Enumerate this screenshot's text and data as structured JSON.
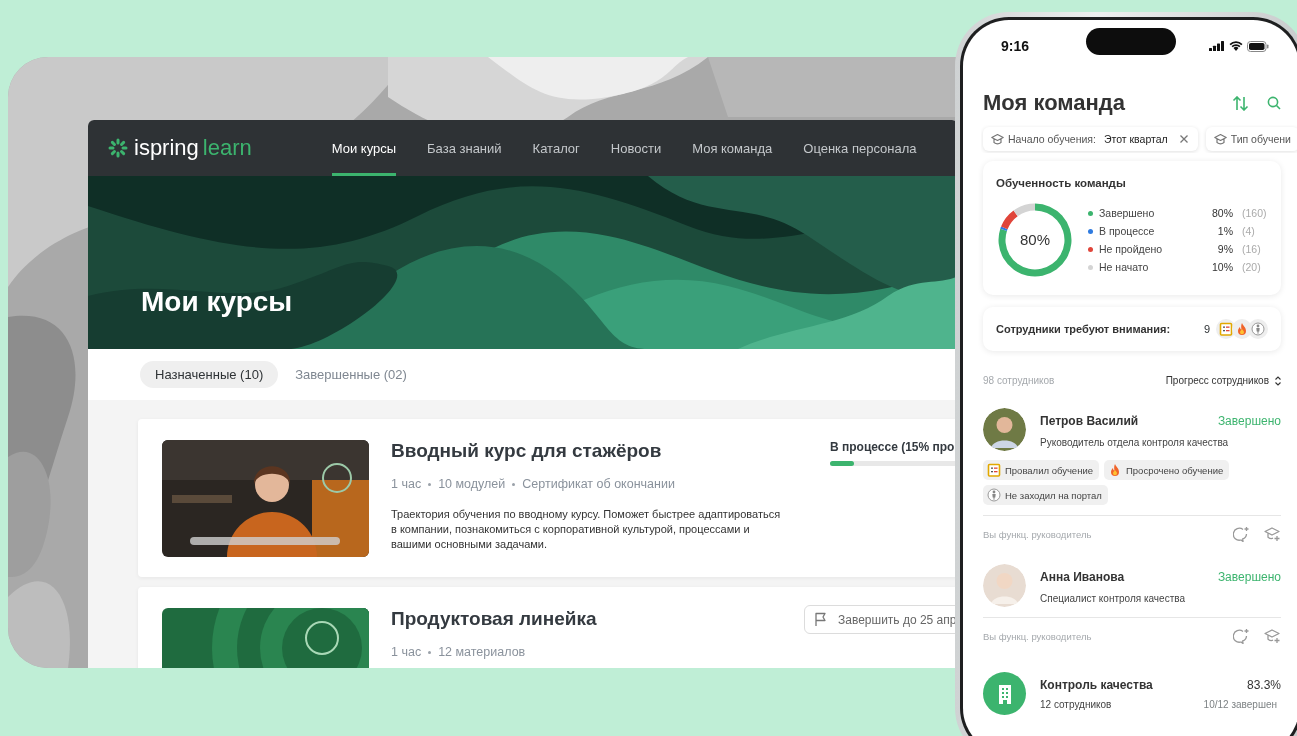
{
  "desktop": {
    "logo": {
      "brand": "ispring",
      "product": "learn"
    },
    "nav": [
      {
        "label": "Мои курсы",
        "selected": true
      },
      {
        "label": "База знаний",
        "selected": false
      },
      {
        "label": "Каталог",
        "selected": false
      },
      {
        "label": "Новости",
        "selected": false
      },
      {
        "label": "Моя команда",
        "selected": false
      },
      {
        "label": "Оценка персонала",
        "selected": false
      }
    ],
    "hero_title": "Мои курсы",
    "tabs": [
      {
        "label": "Назначенные (10)",
        "selected": true
      },
      {
        "label": "Завершенные (02)",
        "selected": false
      }
    ],
    "courses": [
      {
        "kind": "picture",
        "title": "Вводный курс для стажёров",
        "meta": [
          "1 час",
          "10 модулей",
          "Сертификат об окончании"
        ],
        "description": "Траектория обучения по вводному курсу. Поможет быстрее адаптироваться в компании, познакомиться с корпоративной культурой, процессами и вашими основными задачами.",
        "status": {
          "kind": "progress",
          "label": "В процессе (15% про",
          "level": 0.15
        }
      },
      {
        "kind": "picture",
        "title": "Продуктовая линейка",
        "meta": [
          "1 час",
          "12 материалов"
        ],
        "status": {
          "kind": "deadline",
          "label": "Завершить до 25 апр"
        }
      }
    ]
  },
  "phone": {
    "time": "9:16",
    "title": "Моя команда",
    "filters": [
      {
        "label": "Начало обучения:",
        "value": "Этот квартал",
        "removable": true
      },
      {
        "label": "Тип обучени",
        "removable": false
      }
    ],
    "summary": {
      "title": "Обученность команды",
      "center_label": "80%",
      "chart_data": {
        "type": "donut",
        "categories": [
          "Завершено",
          "В процессе",
          "Не пройдено",
          "Не начато"
        ],
        "values": [
          80,
          1,
          9,
          10
        ]
      },
      "legend": [
        {
          "percent": "80%",
          "count": "(160)",
          "color": "#3cb46e"
        },
        {
          "percent": "1%",
          "count": "(4)",
          "color": "#2f7be0"
        },
        {
          "percent": "9%",
          "count": "(16)",
          "color": "#e0453a"
        },
        {
          "percent": "10%",
          "count": "(20)",
          "color": "#d4d4d4"
        }
      ]
    },
    "attention": {
      "label": "Сотрудники требуют внимания:",
      "count": "9",
      "icons": [
        {
          "kind": "failed"
        },
        {
          "kind": "overdue"
        },
        {
          "kind": "absent"
        }
      ]
    },
    "list_header": {
      "count": "98 сотрудников",
      "sort": "Прогресс сотрудников"
    },
    "employees": [
      {
        "name": "Петров Василий",
        "status": "Завершено",
        "role": "Руководитель отдела контроля качества",
        "tags": [
          {
            "kind": "failed",
            "label": "Провалил обучение"
          },
          {
            "kind": "overdue",
            "label": "Просрочено обучение"
          },
          {
            "kind": "absent",
            "label": "Не заходил на портал"
          }
        ],
        "footer": "Вы функц. руководитель"
      },
      {
        "name": "Анна Иванова",
        "status": "Завершено",
        "role": "Специалист контроля качества",
        "footer": "Вы функц. руководитель"
      }
    ],
    "department": {
      "name": "Контроль качества",
      "percent": "83.3%",
      "count": "12 сотрудников",
      "done": "10/12 завершен"
    }
  }
}
